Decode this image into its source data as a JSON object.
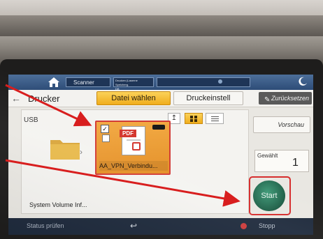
{
  "topbar": {
    "scanner_tab": "Scanner",
    "job_tab_line1": "Drucken (Laserne Speicherg.",
    "job_tab_line2": "DB"
  },
  "header": {
    "title": "Drucker",
    "tab_select_file": "Datei wählen",
    "tab_print_settings": "Druckeinstell",
    "reset_label": "Zurücksetzen"
  },
  "file_pane": {
    "location": "USB",
    "items": [
      {
        "label": "System Volume Inf...",
        "type": "folder",
        "selected": false
      },
      {
        "label": "AA_VPN_Verbindu...",
        "type": "pdf",
        "selected": true
      }
    ]
  },
  "right_panel": {
    "preview_label": "Vorschau",
    "quantity_label": "Gewählt",
    "quantity_value": "1",
    "start_label": "Start"
  },
  "bottombar": {
    "status_label": "Status prüfen",
    "stop_label": "Stopp"
  },
  "colors": {
    "selected_tab": "#f0ad1c",
    "start_button": "#1d5e46",
    "highlight_red": "#d62b2b"
  }
}
